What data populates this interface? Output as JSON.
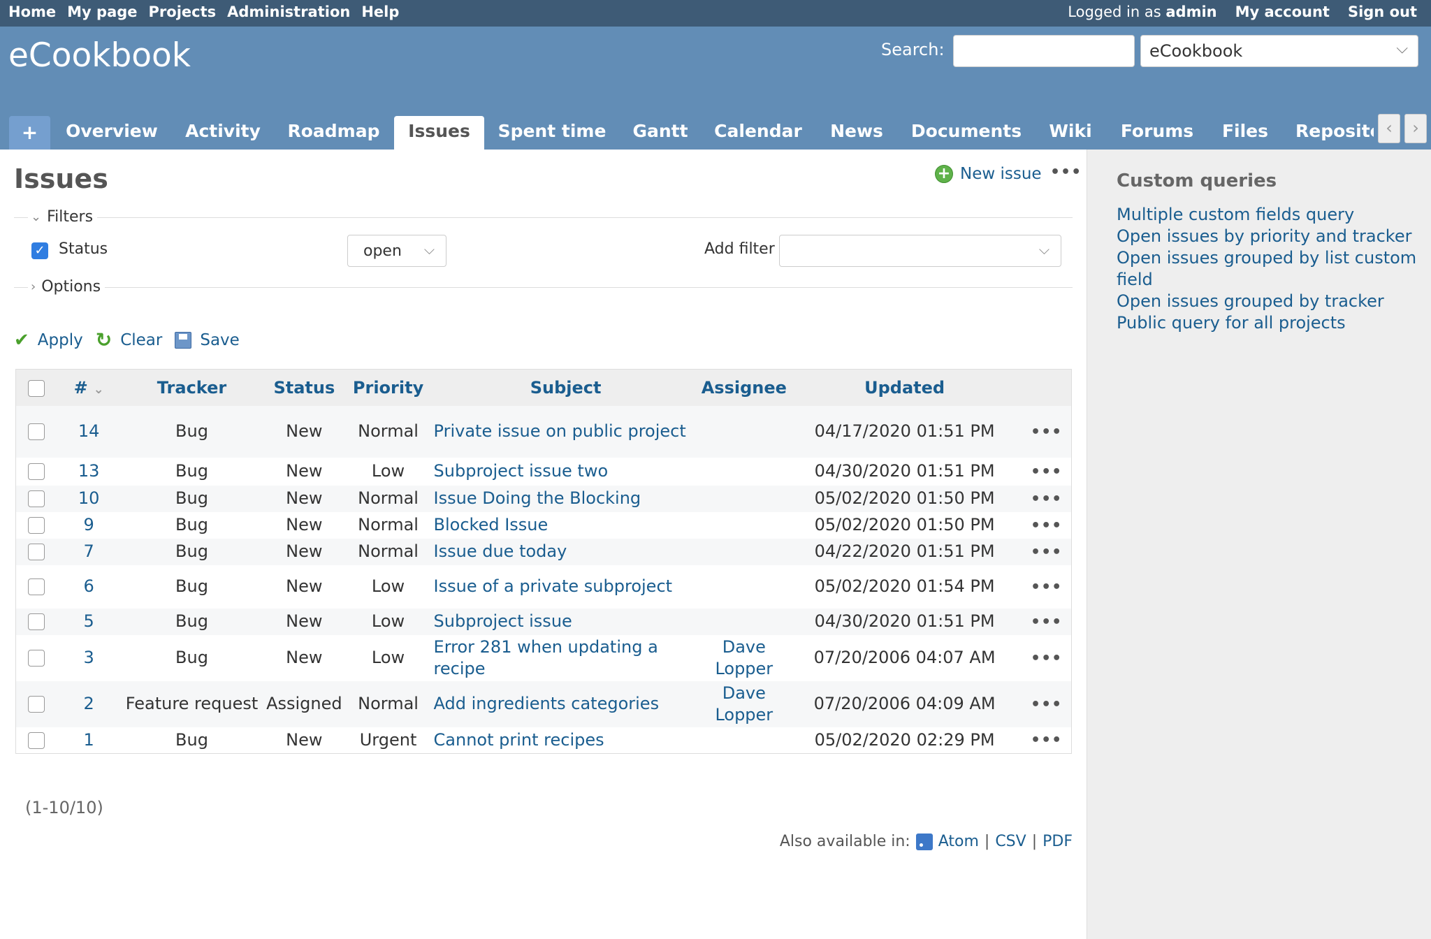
{
  "top_menu": {
    "items": [
      "Home",
      "My page",
      "Projects",
      "Administration",
      "Help"
    ],
    "logged_in_prefix": "Logged in as",
    "logged_in_user": "admin",
    "my_account": "My account",
    "sign_out": "Sign out"
  },
  "header": {
    "project_title": "eCookbook",
    "search_label": "Search:",
    "search_value": "",
    "project_jump": "eCookbook"
  },
  "tabs": {
    "new": "+",
    "items": [
      "Overview",
      "Activity",
      "Roadmap",
      "Issues",
      "Spent time",
      "Gantt",
      "Calendar",
      "News",
      "Documents",
      "Wiki",
      "Forums",
      "Files",
      "Reposito"
    ],
    "selected": "Issues"
  },
  "content": {
    "title": "Issues",
    "new_issue": "New issue",
    "dots": "•••",
    "filters_legend": "Filters",
    "filter_status_label": "Status",
    "filter_status_operator": "open",
    "add_filter_label": "Add filter",
    "options_legend": "Options",
    "apply": "Apply",
    "clear": "Clear",
    "save": "Save"
  },
  "table": {
    "columns": [
      "#",
      "Tracker",
      "Status",
      "Priority",
      "Subject",
      "Assignee",
      "Updated"
    ],
    "rows": [
      {
        "id": "14",
        "tracker": "Bug",
        "status": "New",
        "priority": "Normal",
        "subject": "Private issue on public project",
        "assignee": "",
        "updated": "04/17/2020 01:51 PM"
      },
      {
        "id": "13",
        "tracker": "Bug",
        "status": "New",
        "priority": "Low",
        "subject": "Subproject issue two",
        "assignee": "",
        "updated": "04/30/2020 01:51 PM"
      },
      {
        "id": "10",
        "tracker": "Bug",
        "status": "New",
        "priority": "Normal",
        "subject": "Issue Doing the Blocking",
        "assignee": "",
        "updated": "05/02/2020 01:50 PM"
      },
      {
        "id": "9",
        "tracker": "Bug",
        "status": "New",
        "priority": "Normal",
        "subject": "Blocked Issue",
        "assignee": "",
        "updated": "05/02/2020 01:50 PM"
      },
      {
        "id": "7",
        "tracker": "Bug",
        "status": "New",
        "priority": "Normal",
        "subject": "Issue due today",
        "assignee": "",
        "updated": "04/22/2020 01:51 PM"
      },
      {
        "id": "6",
        "tracker": "Bug",
        "status": "New",
        "priority": "Low",
        "subject": "Issue of a private subproject",
        "assignee": "",
        "updated": "05/02/2020 01:54 PM"
      },
      {
        "id": "5",
        "tracker": "Bug",
        "status": "New",
        "priority": "Low",
        "subject": "Subproject issue",
        "assignee": "",
        "updated": "04/30/2020 01:51 PM"
      },
      {
        "id": "3",
        "tracker": "Bug",
        "status": "New",
        "priority": "Low",
        "subject": "Error 281 when updating a recipe",
        "assignee": "Dave Lopper",
        "updated": "07/20/2006 04:07 AM"
      },
      {
        "id": "2",
        "tracker": "Feature request",
        "status": "Assigned",
        "priority": "Normal",
        "subject": "Add ingredients categories",
        "assignee": "Dave Lopper",
        "updated": "07/20/2006 04:09 AM"
      },
      {
        "id": "1",
        "tracker": "Bug",
        "status": "New",
        "priority": "Urgent",
        "subject": "Cannot print recipes",
        "assignee": "",
        "updated": "05/02/2020 02:29 PM"
      }
    ]
  },
  "pagination": "(1-10/10)",
  "other_formats": {
    "label": "Also available in:",
    "atom": "Atom",
    "csv": "CSV",
    "pdf": "PDF",
    "sep": "|"
  },
  "sidebar": {
    "title": "Custom queries",
    "queries": [
      "Multiple custom fields query",
      "Open issues by priority and tracker",
      "Open issues grouped by list custom field",
      "Open issues grouped by tracker",
      "Public query for all projects"
    ]
  },
  "colors": {
    "top_menu_bg": "#3e5b76",
    "header_bg": "#628db6",
    "link": "#1a5d8f",
    "sidebar_bg": "#eeeeee"
  },
  "icons": [
    "plus-icon",
    "check-icon",
    "refresh-icon",
    "save-icon",
    "rss-icon",
    "chevron-down-icon",
    "chevron-right-icon",
    "chevron-left-icon"
  ]
}
